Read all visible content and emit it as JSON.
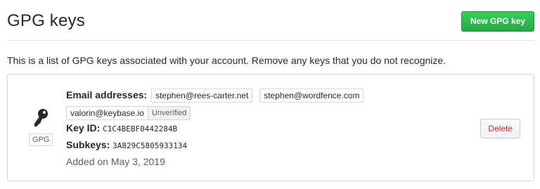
{
  "header": {
    "title": "GPG keys",
    "new_key_label": "New GPG key"
  },
  "intro_text": "This is a list of GPG keys associated with your account. Remove any keys that you do not recognize.",
  "key": {
    "type_label": "GPG",
    "email_label": "Email addresses:",
    "emails": [
      "stephen@rees-carter.net",
      "stephen@wordfence.com",
      "valorin@keybase.io"
    ],
    "unverified_label": "Unverified",
    "key_id_label": "Key ID:",
    "key_id": "C1C4BEBF0442284B",
    "subkeys_label": "Subkeys:",
    "subkeys": "3A829C5805933134",
    "added_text": "Added on May 3, 2019",
    "delete_label": "Delete"
  },
  "colors": {
    "primary_button": "#2cbe4e",
    "danger_text": "#cb2431",
    "border": "#d1d5da"
  },
  "icons": {
    "key": "key-icon"
  }
}
